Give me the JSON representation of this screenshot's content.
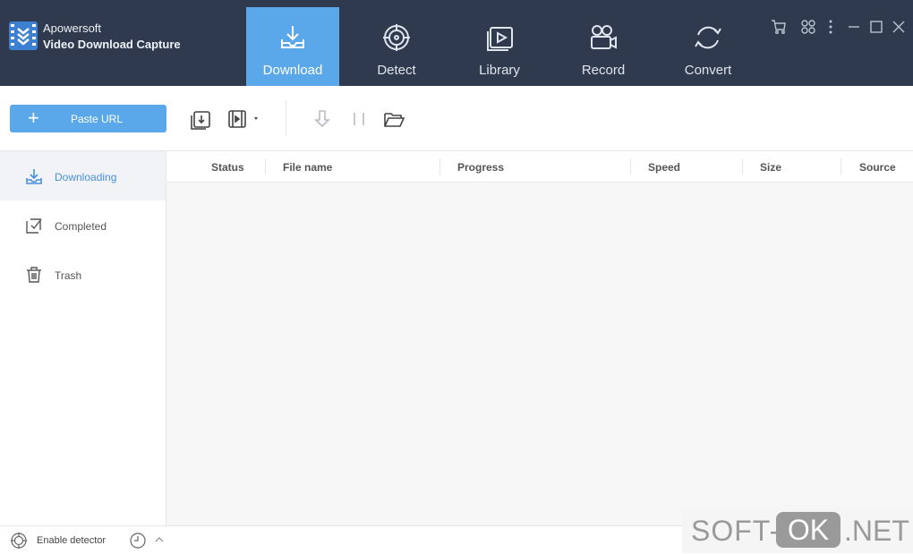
{
  "app": {
    "name_line1": "Apowersoft",
    "name_line2": "Video Download Capture"
  },
  "tabs": [
    {
      "label": "Download",
      "icon": "download-icon",
      "active": true
    },
    {
      "label": "Detect",
      "icon": "detect-icon",
      "active": false
    },
    {
      "label": "Library",
      "icon": "library-icon",
      "active": false
    },
    {
      "label": "Record",
      "icon": "record-icon",
      "active": false
    },
    {
      "label": "Convert",
      "icon": "convert-icon",
      "active": false
    }
  ],
  "window_controls": [
    "cart-icon",
    "grid-icon",
    "more-icon",
    "minimize-icon",
    "maximize-icon",
    "close-icon"
  ],
  "toolbar": {
    "paste_url_label": "Paste URL",
    "icons": [
      "import-download-icon",
      "video-menu-icon",
      "resume-icon",
      "pause-icon",
      "open-folder-icon"
    ]
  },
  "sidebar": {
    "items": [
      {
        "label": "Downloading",
        "icon": "download-tray-icon",
        "active": true
      },
      {
        "label": "Completed",
        "icon": "check-doc-icon",
        "active": false
      },
      {
        "label": "Trash",
        "icon": "trash-icon",
        "active": false
      }
    ]
  },
  "table": {
    "columns": [
      "Status",
      "File name",
      "Progress",
      "Speed",
      "Size",
      "Source"
    ],
    "rows": []
  },
  "statusbar": {
    "detector_label": "Enable detector"
  },
  "watermark": {
    "part1": "SOFT-",
    "part2": "OK",
    "part3": ".NET"
  },
  "colors": {
    "titlebar": "#2f3a4e",
    "accent": "#5aa8ea",
    "active_text": "#4a90d9"
  }
}
